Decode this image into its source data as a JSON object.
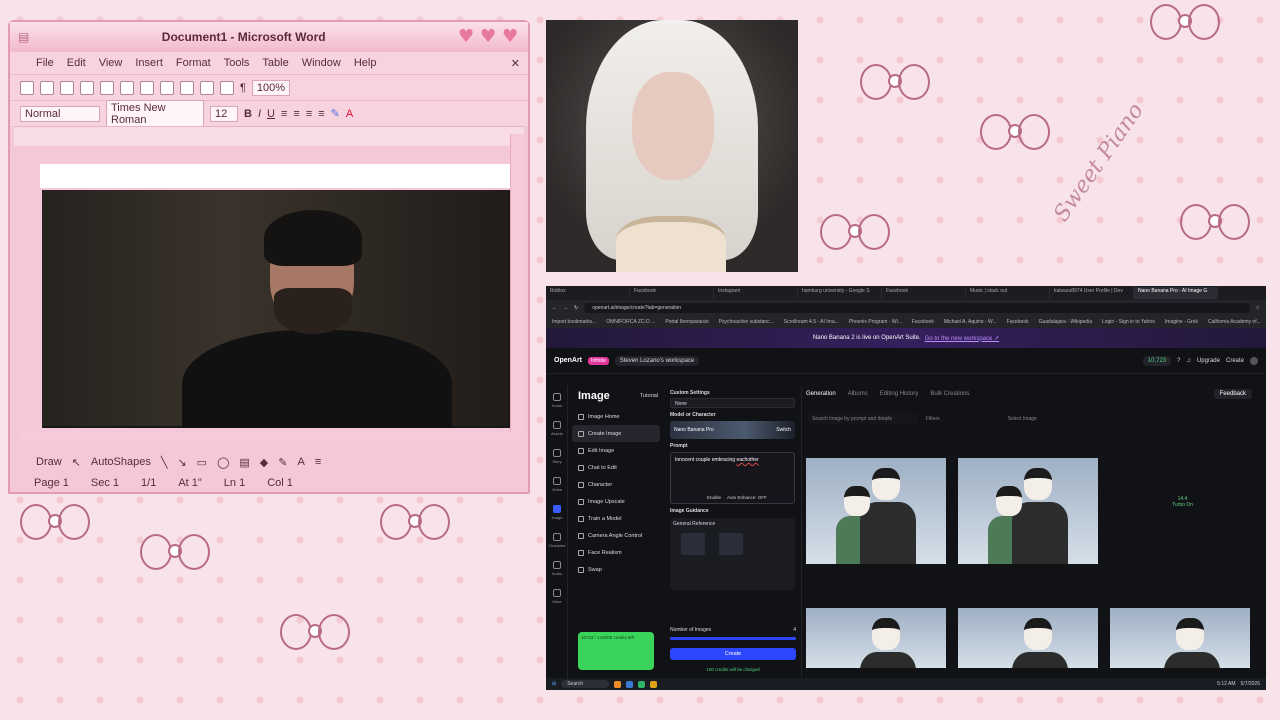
{
  "word": {
    "title": "Document1 - Microsoft Word",
    "menu": [
      "File",
      "Edit",
      "View",
      "Insert",
      "Format",
      "Tools",
      "Table",
      "Window",
      "Help"
    ],
    "style": "Normal",
    "font": "Times New Roman",
    "size": "12",
    "zoom": "100%",
    "draw_label": "Draw",
    "autoshapes_label": "AutoShapes",
    "status": {
      "page": "Page 1",
      "sec": "Sec 1",
      "pages": "1/1",
      "at": "At 1\"",
      "ln": "Ln 1",
      "col": "Col 1"
    }
  },
  "wallpaper": {
    "text": "Sweet Piano"
  },
  "browser": {
    "tabs": [
      "Roblox",
      "Facebook",
      "Instagram",
      "hamburg university - Google S",
      "Facebook",
      "Music | stack out",
      "kaiwaru8974 User Profile | Dev",
      "Nano Banana Pro - AI Image G"
    ],
    "url": "openart.ai/image/create?tab=generation",
    "bookmarks": [
      "Import bookmarks...",
      "OMNIFORCA ZC-D ...",
      "Portal Iberoparaisio",
      "Psychoactive substanc...",
      "Scrollream 4.5 - AI Ima...",
      "Phoenix Program - Wi...",
      "Facebook",
      "Michael A. Aquino - W...",
      "Facebook",
      "Guadalajara - Wikipedia",
      "Login - Sign in to Yahoo",
      "Imagine - Grok",
      "California Academy of..."
    ],
    "window_title": "Nano Banana Pro - AI Image Generator | OpenArt — Mozilla Firefox",
    "banner": {
      "text": "Nano Banana 2 is live on OpenArt Suite.",
      "link": "Go to the new workspace ↗"
    },
    "openart": {
      "logo": "OpenArt",
      "badge": "Infinite",
      "workspace": "Steven Lozano's workspace",
      "credits": "10,723",
      "upgrade": "Upgrade",
      "create": "Create",
      "section_title": "Image",
      "tutorial": "Tutorial",
      "nav": [
        "Image Home",
        "Create Image",
        "Edit Image",
        "Chat to Edit",
        "Character",
        "Image Upscale",
        "Train a Model",
        "Camera Angle Control",
        "Face Realism",
        "Swap"
      ],
      "rail": [
        "Home",
        "Assets",
        "Story",
        "Video",
        "Image",
        "Character",
        "Audio",
        "More"
      ],
      "custom_settings": "Custom Settings",
      "custom_value": "None",
      "model_label": "Model or Character",
      "model_name": "Nano Banana Pro",
      "switch": "Switch",
      "prompt_label": "Prompt",
      "prompt_text_a": "Innocent couple embracing",
      "prompt_text_b": "eachother",
      "prompt_tag": "Enable",
      "auto_enhance": "Auto Enhance: OFF",
      "guidance_label": "Image Guidance",
      "general_ref": "General Reference",
      "num_images_label": "Number of Images",
      "num_images": "4",
      "create_btn": "Create",
      "credits_note": "100 credits will be charged",
      "credits_box": "10723 / 144000 credits left",
      "gallery_tabs": [
        "Generation",
        "Albums",
        "Editing History",
        "Bulk Creations"
      ],
      "feedback": "Feedback",
      "search_placeholder": "Search image by prompt and details",
      "filters": "Filters",
      "select_image": "Select Image",
      "turbo": "Turbo On",
      "turbo_num": "14.4"
    },
    "taskbar": {
      "search": "Search",
      "time": "5:12 AM",
      "date": "5/7/2026"
    }
  }
}
